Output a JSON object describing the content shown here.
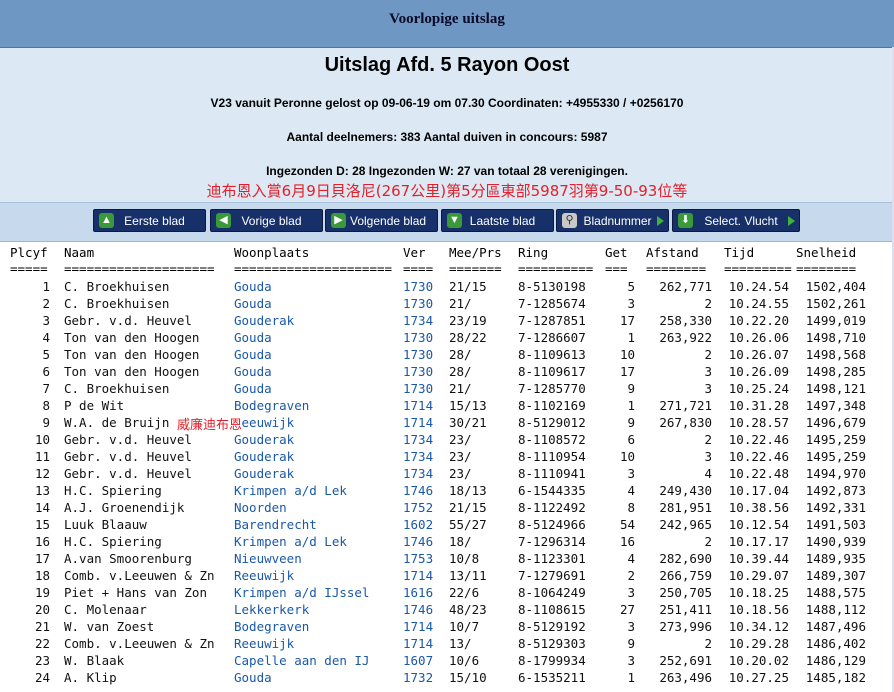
{
  "top_title": "Voorlopige uitslag",
  "main_title": "Uitslag Afd. 5 Rayon Oost",
  "info": {
    "line1": "V23 vanuit Peronne gelost op 09-06-19 om 07.30 Coordinaten: +4955330 / +0256170",
    "line2": "Aantal deelnemers: 383 Aantal duiven in concours: 5987",
    "line3": "Ingezonden D: 28 Ingezonden W: 27 van totaal 28 verenigingen."
  },
  "annotation": "迪布恩入賞6月9日貝洛尼(267公里)第5分區東部5987羽第9-50-93位等",
  "row_annotation": "威廉迪布恩",
  "nav": {
    "first": "Eerste blad",
    "prev": "Vorige blad",
    "next": "Volgende blad",
    "last": "Laatste blad",
    "pagenum": "Bladnummer",
    "flight": "Select. Vlucht"
  },
  "table": {
    "headers": [
      "Plcyf",
      "Naam",
      "Woonplaats",
      "Ver",
      "Mee/Prs",
      "Ring",
      "Get",
      "Afstand",
      "Tijd",
      "Snelheid"
    ],
    "separators": [
      "=====",
      "====================",
      "=====================",
      "====",
      "=======",
      "==========",
      "===",
      "========",
      "=========",
      "========"
    ],
    "rows": [
      [
        "1",
        "C. Broekhuisen",
        "Gouda",
        "1730",
        "21/15",
        "8-5130198",
        "5",
        "262,771",
        "10.24.54",
        "1502,404"
      ],
      [
        "2",
        "C. Broekhuisen",
        "Gouda",
        "1730",
        "21/",
        "7-1285674",
        "3",
        "2",
        "10.24.55",
        "1502,261"
      ],
      [
        "3",
        "Gebr. v.d. Heuvel",
        "Gouderak",
        "1734",
        "23/19",
        "7-1287851",
        "17",
        "258,330",
        "10.22.20",
        "1499,019"
      ],
      [
        "4",
        "Ton van den Hoogen",
        "Gouda",
        "1730",
        "28/22",
        "7-1286607",
        "1",
        "263,922",
        "10.26.06",
        "1498,710"
      ],
      [
        "5",
        "Ton van den Hoogen",
        "Gouda",
        "1730",
        "28/",
        "8-1109613",
        "10",
        "2",
        "10.26.07",
        "1498,568"
      ],
      [
        "6",
        "Ton van den Hoogen",
        "Gouda",
        "1730",
        "28/",
        "8-1109617",
        "17",
        "3",
        "10.26.09",
        "1498,285"
      ],
      [
        "7",
        "C. Broekhuisen",
        "Gouda",
        "1730",
        "21/",
        "7-1285770",
        "9",
        "3",
        "10.25.24",
        "1498,121"
      ],
      [
        "8",
        "P de Wit",
        "Bodegraven",
        "1714",
        "15/13",
        "8-1102169",
        "1",
        "271,721",
        "10.31.28",
        "1497,348"
      ],
      [
        "9",
        "W.A. de Bruijn",
        "Reeuwijk",
        "1714",
        "30/21",
        "8-5129012",
        "9",
        "267,830",
        "10.28.57",
        "1496,679"
      ],
      [
        "10",
        "Gebr. v.d. Heuvel",
        "Gouderak",
        "1734",
        "23/",
        "8-1108572",
        "6",
        "2",
        "10.22.46",
        "1495,259"
      ],
      [
        "11",
        "Gebr. v.d. Heuvel",
        "Gouderak",
        "1734",
        "23/",
        "8-1110954",
        "10",
        "3",
        "10.22.46",
        "1495,259"
      ],
      [
        "12",
        "Gebr. v.d. Heuvel",
        "Gouderak",
        "1734",
        "23/",
        "8-1110941",
        "3",
        "4",
        "10.22.48",
        "1494,970"
      ],
      [
        "13",
        "H.C. Spiering",
        "Krimpen a/d Lek",
        "1746",
        "18/13",
        "6-1544335",
        "4",
        "249,430",
        "10.17.04",
        "1492,873"
      ],
      [
        "14",
        "A.J. Groenendijk",
        "Noorden",
        "1752",
        "21/15",
        "8-1122492",
        "8",
        "281,951",
        "10.38.56",
        "1492,331"
      ],
      [
        "15",
        "Luuk Blaauw",
        "Barendrecht",
        "1602",
        "55/27",
        "8-5124966",
        "54",
        "242,965",
        "10.12.54",
        "1491,503"
      ],
      [
        "16",
        "H.C. Spiering",
        "Krimpen a/d Lek",
        "1746",
        "18/",
        "7-1296314",
        "16",
        "2",
        "10.17.17",
        "1490,939"
      ],
      [
        "17",
        "A.van Smoorenburg",
        "Nieuwveen",
        "1753",
        "10/8",
        "8-1123301",
        "4",
        "282,690",
        "10.39.44",
        "1489,935"
      ],
      [
        "18",
        "Comb. v.Leeuwen & Zn",
        "Reeuwijk",
        "1714",
        "13/11",
        "7-1279691",
        "2",
        "266,759",
        "10.29.07",
        "1489,307"
      ],
      [
        "19",
        "Piet + Hans van Zon",
        "Krimpen a/d IJssel",
        "1616",
        "22/6",
        "8-1064249",
        "3",
        "250,705",
        "10.18.25",
        "1488,575"
      ],
      [
        "20",
        "C. Molenaar",
        "Lekkerkerk",
        "1746",
        "48/23",
        "8-1108615",
        "27",
        "251,411",
        "10.18.56",
        "1488,112"
      ],
      [
        "21",
        "W. van Zoest",
        "Bodegraven",
        "1714",
        "10/7",
        "8-5129192",
        "3",
        "273,996",
        "10.34.12",
        "1487,496"
      ],
      [
        "22",
        "Comb. v.Leeuwen & Zn",
        "Reeuwijk",
        "1714",
        "13/",
        "8-5129303",
        "9",
        "2",
        "10.29.28",
        "1486,402"
      ],
      [
        "23",
        "W. Blaak",
        "Capelle aan den IJ",
        "1607",
        "10/6",
        "8-1799934",
        "3",
        "252,691",
        "10.20.02",
        "1486,129"
      ],
      [
        "24",
        "A. Klip",
        "Gouda",
        "1732",
        "15/10",
        "6-1535211",
        "1",
        "263,496",
        "10.27.25",
        "1485,182"
      ]
    ]
  }
}
